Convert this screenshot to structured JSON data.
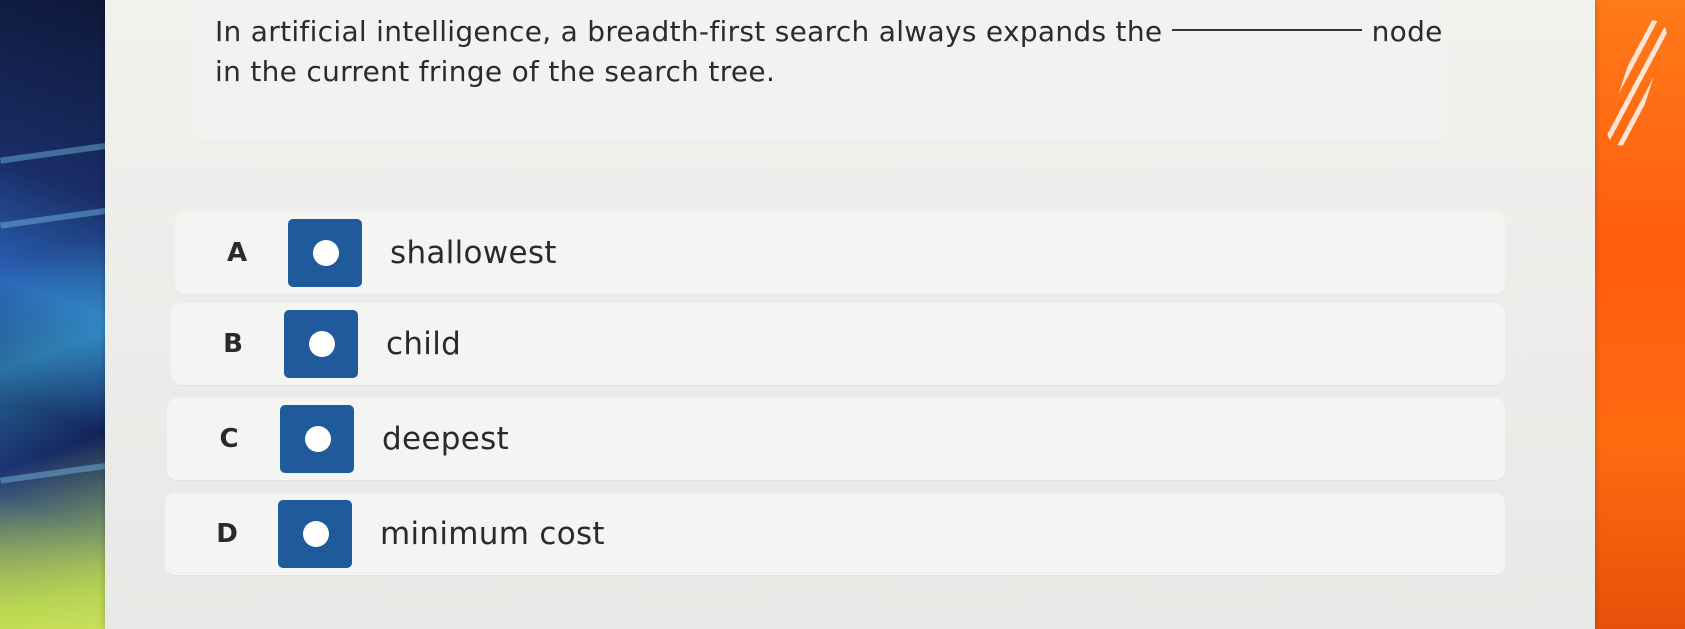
{
  "question": {
    "text": "In artificial intelligence, a breadth-first search always expands the node in the current fringe of the search tree."
  },
  "options": [
    {
      "letter": "A",
      "label": "shallowest"
    },
    {
      "letter": "B",
      "label": "child"
    },
    {
      "letter": "C",
      "label": "deepest"
    },
    {
      "letter": "D",
      "label": "minimum cost"
    }
  ],
  "colors": {
    "radio_button": "#1f5a9b",
    "radio_dot": "#ffffff",
    "page_background": "#ecedea"
  }
}
